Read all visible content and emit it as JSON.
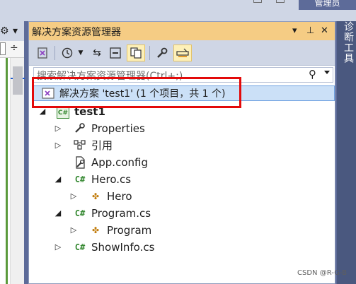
{
  "top": {
    "login_label": "管理员"
  },
  "window": {
    "title": "解决方案资源管理器",
    "controls": [
      "▾",
      "⊥",
      "✕"
    ]
  },
  "toolbar": {
    "buttons": [
      "vs-switch-icon",
      "history-icon",
      "dropdown-icon",
      "sync-icon",
      "collapse-icon",
      "show-all-files-icon",
      "wrench-icon",
      "preview-icon"
    ]
  },
  "search": {
    "placeholder": "搜索解决方案资源管理器(Ctrl+;)"
  },
  "tree": {
    "solution": "解决方案 'test1' (1 个项目，共 1 个)",
    "project": "test1",
    "items": [
      {
        "label": "Properties",
        "icon": "wrench-icon"
      },
      {
        "label": "引用",
        "icon": "references-icon"
      },
      {
        "label": "App.config",
        "icon": "config-icon"
      },
      {
        "label": "Hero.cs",
        "icon": "csharp-icon"
      },
      {
        "label": "Hero",
        "icon": "class-icon"
      },
      {
        "label": "Program.cs",
        "icon": "csharp-icon"
      },
      {
        "label": "Program",
        "icon": "class-icon"
      },
      {
        "label": "ShowInfo.cs",
        "icon": "csharp-icon"
      }
    ]
  },
  "right_tab": {
    "label": "诊断工具"
  },
  "watermark": "CSDN @R-G-B"
}
